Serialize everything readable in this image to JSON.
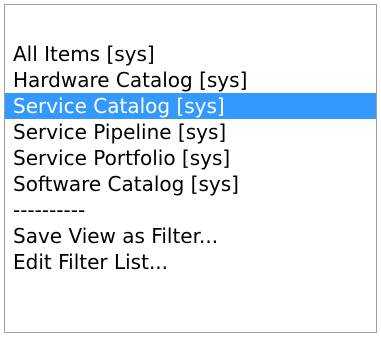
{
  "menu": {
    "items": [
      {
        "label": ""
      },
      {
        "label": "All Items [sys]"
      },
      {
        "label": "Hardware Catalog [sys]"
      },
      {
        "label": "Service Catalog [sys]",
        "selected": true
      },
      {
        "label": "Service Pipeline [sys]"
      },
      {
        "label": "Service Portfolio [sys]"
      },
      {
        "label": "Software Catalog [sys]"
      },
      {
        "label": "----------"
      },
      {
        "label": "Save View as Filter..."
      },
      {
        "label": "Edit Filter List..."
      }
    ]
  },
  "colors": {
    "selection_bg": "#3399ff",
    "selection_fg": "#ffffff",
    "border": "#a0a0a0"
  }
}
